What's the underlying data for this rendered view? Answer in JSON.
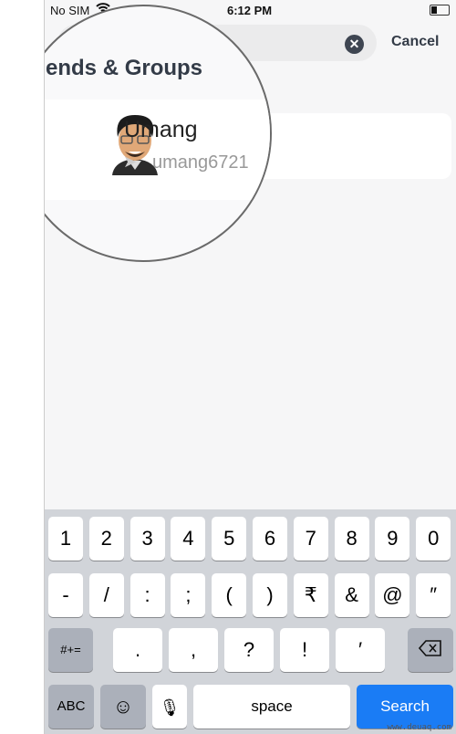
{
  "status": {
    "carrier": "No SIM",
    "time": "6:12 PM",
    "battery_level": 0.35
  },
  "search": {
    "clear_icon": "x-circle-icon",
    "cancel_label": "Cancel"
  },
  "section_title": "riends & Groups",
  "result": {
    "name": "Umang",
    "username": "umang6721",
    "send_icon": "send-arrow-icon"
  },
  "keyboard": {
    "row1": [
      "1",
      "2",
      "3",
      "4",
      "5",
      "6",
      "7",
      "8",
      "9",
      "0"
    ],
    "row2": [
      "-",
      "/",
      ":",
      ";",
      "(",
      ")",
      "₹",
      "&",
      "@",
      "″"
    ],
    "row3": [
      ".",
      ",",
      "?",
      "!",
      "′"
    ],
    "symbols_label": "#+=",
    "abc_label": "ABC",
    "space_label": "space",
    "search_label": "Search",
    "accent": "#1a7cf5"
  },
  "watermark": "www.deuaq.com"
}
